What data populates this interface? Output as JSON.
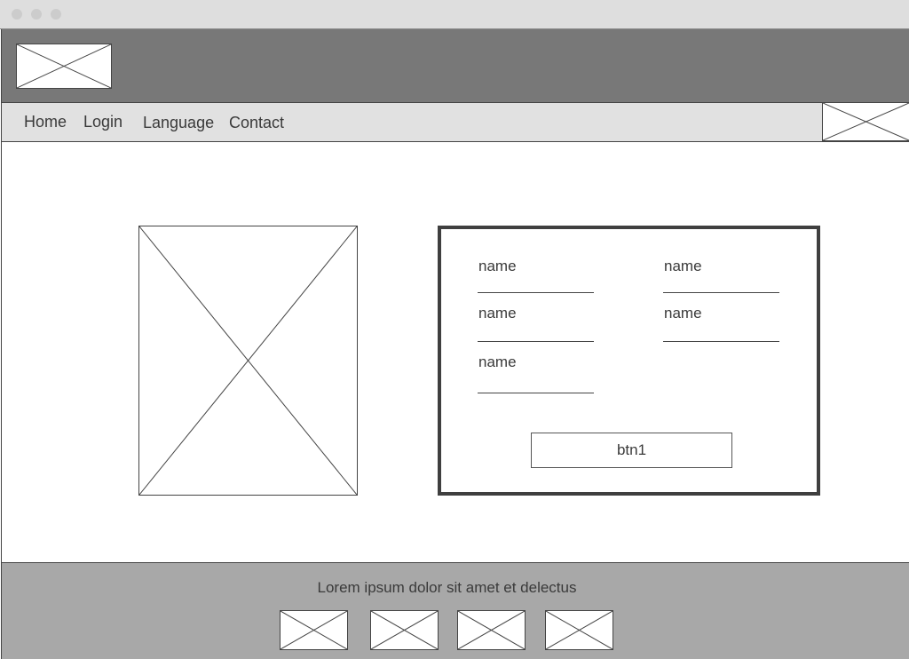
{
  "window": {
    "controls": [
      "close-dot",
      "minimize-dot",
      "maximize-dot"
    ]
  },
  "header": {
    "logo_icon": "image-placeholder-icon"
  },
  "nav": {
    "items": [
      {
        "label": "Home"
      },
      {
        "label": "Login"
      },
      {
        "label": "Language"
      },
      {
        "label": "Contact"
      }
    ],
    "right_icon": "image-placeholder-icon"
  },
  "main": {
    "image_icon": "image-placeholder-icon",
    "form": {
      "fields": [
        {
          "label": "name",
          "value": ""
        },
        {
          "label": "name",
          "value": ""
        },
        {
          "label": "name",
          "value": ""
        },
        {
          "label": "name",
          "value": ""
        },
        {
          "label": "name",
          "value": ""
        }
      ],
      "button_label": "btn1"
    }
  },
  "footer": {
    "text": "Lorem ipsum dolor sit amet et delectus",
    "icons": [
      "image-placeholder-icon",
      "image-placeholder-icon",
      "image-placeholder-icon",
      "image-placeholder-icon"
    ]
  },
  "colors": {
    "header_bg": "#787878",
    "nav_bg": "#e1e1e1",
    "footer_bg": "#a8a8a8",
    "titlebar_bg": "#dedede",
    "border": "#444444"
  }
}
